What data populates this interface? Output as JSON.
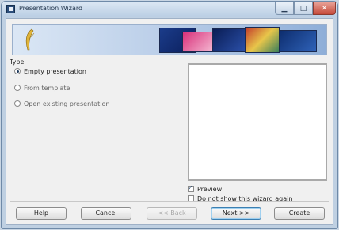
{
  "window": {
    "title": "Presentation Wizard",
    "min_icon": "minimize-icon",
    "max_icon": "maximize-icon",
    "close_icon": "close-icon",
    "min_glyph": "▁",
    "max_glyph": "□",
    "close_glyph": "✕"
  },
  "banner": {
    "logo_icon": "feather-logo-icon"
  },
  "type_group": {
    "label": "Type",
    "options": [
      {
        "label": "Empty presentation",
        "selected": true
      },
      {
        "label": "From template",
        "selected": false
      },
      {
        "label": "Open existing presentation",
        "selected": false
      }
    ]
  },
  "preview": {
    "checkbox_label": "Preview",
    "checked": true
  },
  "do_not_show": {
    "label": "Do not show this wizard again",
    "checked": false
  },
  "buttons": {
    "help": "Help",
    "cancel": "Cancel",
    "back": "<< Back",
    "next": "Next >>",
    "create": "Create"
  },
  "colors": {
    "window_frame": "#bfd0e2",
    "close_button": "#c54a3a",
    "dialog_bg": "#f0f0f0"
  }
}
